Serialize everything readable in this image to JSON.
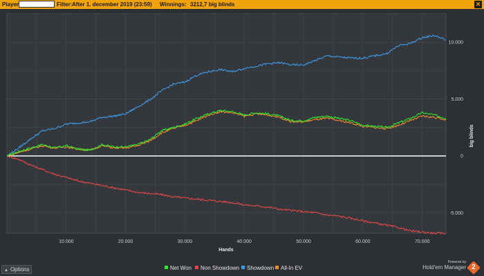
{
  "header": {
    "player_label": "Player:",
    "filter_label": "Filter:",
    "filter_value": "After 1. december 2019 (23:59)",
    "winnings_label": "Winnings:",
    "winnings_value": "3212,7 big blinds"
  },
  "footer": {
    "options_label": "Options",
    "powered_by": "Powered by",
    "brand_name": "Hold'em Manager",
    "brand_badge": "2"
  },
  "colors": {
    "net_won": "#2ee62e",
    "non_showdown": "#e04848",
    "showdown": "#3d9be9",
    "all_in_ev": "#f08c2a",
    "accent": "#f0a30a"
  },
  "chart_data": {
    "type": "line",
    "xlabel": "Hands",
    "ylabel": "big blinds",
    "xlim": [
      0,
      74000
    ],
    "ylim": [
      -6800,
      12500
    ],
    "x_ticks": [
      10000,
      20000,
      30000,
      40000,
      50000,
      60000,
      70000
    ],
    "x_tick_labels": [
      "10.000",
      "20.000",
      "30.000",
      "40.000",
      "50.000",
      "60.000",
      "70.000"
    ],
    "y_ticks": [
      -5000,
      0,
      5000,
      10000
    ],
    "y_tick_labels": [
      "-5.000",
      "0",
      "5.000",
      "10.000"
    ],
    "grid": true,
    "legend_position": "bottom-center",
    "x": [
      0,
      2000,
      4000,
      6000,
      8000,
      10000,
      12000,
      14000,
      16000,
      18000,
      20000,
      22000,
      24000,
      26000,
      28000,
      30000,
      32000,
      34000,
      36000,
      38000,
      40000,
      42000,
      44000,
      46000,
      48000,
      50000,
      52000,
      54000,
      56000,
      58000,
      60000,
      62000,
      64000,
      66000,
      68000,
      70000,
      72000,
      74000
    ],
    "series": [
      {
        "name": "Net Won",
        "values": [
          0,
          400,
          700,
          1000,
          700,
          900,
          600,
          500,
          1000,
          800,
          800,
          1000,
          1400,
          2200,
          2500,
          2800,
          3300,
          3700,
          4000,
          3900,
          3600,
          3800,
          3700,
          3500,
          3100,
          3100,
          3400,
          3500,
          3300,
          3100,
          2700,
          2600,
          2500,
          2900,
          3300,
          3800,
          3600,
          3300
        ]
      },
      {
        "name": "Non Showdown",
        "values": [
          0,
          -300,
          -800,
          -1200,
          -1600,
          -1900,
          -2200,
          -2400,
          -2600,
          -2800,
          -3000,
          -3200,
          -3300,
          -3400,
          -3600,
          -3700,
          -3800,
          -3900,
          -4000,
          -4100,
          -4300,
          -4400,
          -4500,
          -4700,
          -4800,
          -4900,
          -5000,
          -5200,
          -5300,
          -5500,
          -5700,
          -5900,
          -6100,
          -6300,
          -6600,
          -6700,
          -6800,
          -6800
        ]
      },
      {
        "name": "Showdown",
        "values": [
          0,
          700,
          1500,
          2200,
          2400,
          2800,
          2900,
          3000,
          3400,
          3500,
          3700,
          4300,
          4900,
          5700,
          6300,
          6500,
          7100,
          7400,
          7600,
          7400,
          7700,
          7900,
          8100,
          8200,
          8000,
          8000,
          8400,
          8800,
          8700,
          8600,
          8600,
          8800,
          9000,
          9700,
          9900,
          10400,
          10600,
          10200
        ]
      },
      {
        "name": "All-In EV",
        "values": [
          0,
          300,
          600,
          900,
          700,
          800,
          600,
          500,
          900,
          700,
          700,
          900,
          1300,
          2000,
          2400,
          2700,
          3100,
          3600,
          3900,
          3800,
          3500,
          3700,
          3600,
          3400,
          3000,
          3000,
          3200,
          3300,
          3100,
          2900,
          2600,
          2500,
          2400,
          2700,
          3100,
          3500,
          3400,
          3200
        ]
      }
    ]
  }
}
